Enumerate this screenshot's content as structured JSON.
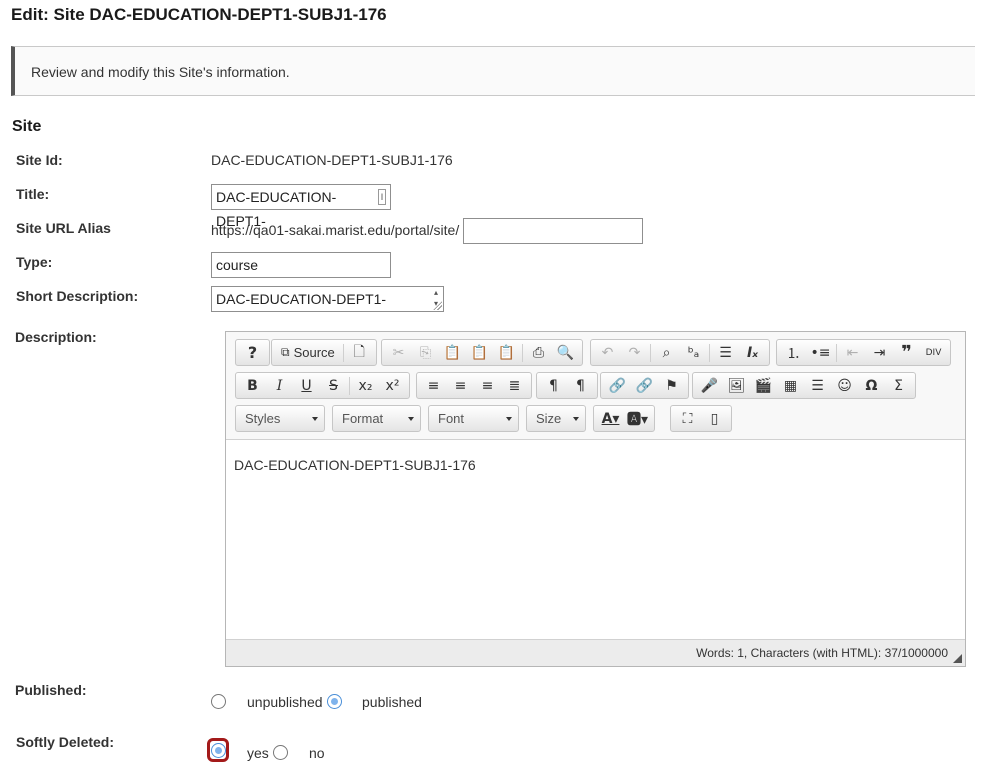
{
  "page": {
    "title": "Edit: Site DAC-EDUCATION-DEPT1-SUBJ1-176",
    "instructions": "Review and modify this Site's information.",
    "section_title": "Site"
  },
  "fields": {
    "site_id": {
      "label": "Site Id:",
      "value": "DAC-EDUCATION-DEPT1-SUBJ1-176"
    },
    "title": {
      "label": "Title:",
      "value": "DAC-EDUCATION-DEPT1-"
    },
    "url_alias": {
      "label": "Site URL Alias",
      "prefix": "https://qa01-sakai.marist.edu/portal/site/",
      "value": ""
    },
    "type": {
      "label": "Type:",
      "value": "course"
    },
    "short_description": {
      "label": "Short Description:",
      "value": "DAC-EDUCATION-DEPT1-"
    },
    "description": {
      "label": "Description:"
    },
    "published": {
      "label": "Published:",
      "options": [
        "unpublished",
        "published"
      ],
      "selected": "published"
    },
    "softly_deleted": {
      "label": "Softly Deleted:",
      "options": [
        "yes",
        "no"
      ],
      "selected": "yes"
    }
  },
  "editor": {
    "source_label": "Source",
    "styles_label": "Styles",
    "format_label": "Format",
    "font_label": "Font",
    "size_label": "Size",
    "content": "DAC-EDUCATION-DEPT1-SUBJ1-176",
    "status": "Words: 1, Characters (with HTML): 37/1000000"
  },
  "colors": {
    "focus_ring": "#a31a1a",
    "radio_checked": "#7fb3ec",
    "info_border": "#555555"
  }
}
